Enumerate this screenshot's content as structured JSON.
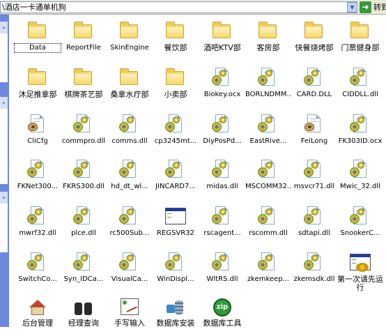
{
  "address_bar": {
    "path": "\\酒店一卡通单机狗",
    "go_label": "转到"
  },
  "files": [
    {
      "label": "Data",
      "type": "folder",
      "selected": true
    },
    {
      "label": "ReportFile",
      "type": "folder"
    },
    {
      "label": "SkinEngine",
      "type": "folder"
    },
    {
      "label": "餐饮部",
      "type": "folder"
    },
    {
      "label": "酒吧KTV部",
      "type": "folder"
    },
    {
      "label": "客房部",
      "type": "folder"
    },
    {
      "label": "快餐烧烤部",
      "type": "folder"
    },
    {
      "label": "门票健身部",
      "type": "folder"
    },
    {
      "label": "沐足推拿部",
      "type": "folder"
    },
    {
      "label": "棋牌茶艺部",
      "type": "folder"
    },
    {
      "label": "桑拿水疗部",
      "type": "folder"
    },
    {
      "label": "小卖部",
      "type": "folder"
    },
    {
      "label": "Biokey.ocx",
      "type": "dll"
    },
    {
      "label": "BORLNDMM...",
      "type": "dll"
    },
    {
      "label": "CARD.DLL",
      "type": "dll"
    },
    {
      "label": "CIDDLL.dll",
      "type": "dll"
    },
    {
      "label": "CliCfg",
      "type": "badge"
    },
    {
      "label": "commpro.dll",
      "type": "dll"
    },
    {
      "label": "comms.dll",
      "type": "dll"
    },
    {
      "label": "cp3245mt...",
      "type": "dll"
    },
    {
      "label": "DiyPosPd...",
      "type": "dll"
    },
    {
      "label": "EastRive...",
      "type": "dll"
    },
    {
      "label": "FeiLong",
      "type": "badge"
    },
    {
      "label": "FK303ID.ocx",
      "type": "dll"
    },
    {
      "label": "FKNet300...",
      "type": "dll"
    },
    {
      "label": "FKRS300.dll",
      "type": "dll"
    },
    {
      "label": "hd_dt_wl...",
      "type": "dll"
    },
    {
      "label": "JINCARD7...",
      "type": "dll"
    },
    {
      "label": "midas.dll",
      "type": "dll"
    },
    {
      "label": "MSCOMM32...",
      "type": "dll"
    },
    {
      "label": "msvcr71.dll",
      "type": "dll"
    },
    {
      "label": "Mwic_32.dll",
      "type": "dll"
    },
    {
      "label": "mwrf32.dll",
      "type": "dll"
    },
    {
      "label": "plce.dll",
      "type": "dll"
    },
    {
      "label": "rc500Sub...",
      "type": "dll"
    },
    {
      "label": "REGSVR32",
      "type": "exe"
    },
    {
      "label": "rscagent...",
      "type": "dll"
    },
    {
      "label": "rscomm.dll",
      "type": "dll"
    },
    {
      "label": "sdtapi.dll",
      "type": "dll"
    },
    {
      "label": "SnookerC...",
      "type": "dll"
    },
    {
      "label": "SwitchCo...",
      "type": "dll"
    },
    {
      "label": "Syn_IDCa...",
      "type": "dll"
    },
    {
      "label": "VisualCa...",
      "type": "dll"
    },
    {
      "label": "WinDispl...",
      "type": "dll"
    },
    {
      "label": "WltRS.dll",
      "type": "dll"
    },
    {
      "label": "zkemkeep...",
      "type": "dll"
    },
    {
      "label": "zkemsdk.dll",
      "type": "dll"
    },
    {
      "label": "第一次请先运行",
      "type": "exe-gear"
    },
    {
      "label": "后台管理",
      "type": "house"
    },
    {
      "label": "经理查询",
      "type": "binoc"
    },
    {
      "label": "手写输入",
      "type": "pen"
    },
    {
      "label": "数据库安装",
      "type": "db"
    },
    {
      "label": "数据库工具",
      "type": "zip",
      "glyph": "zip"
    }
  ],
  "colors": {
    "pane": "#6c87de",
    "folder": "#f7d96e",
    "go_button": "#3a9a3a"
  }
}
